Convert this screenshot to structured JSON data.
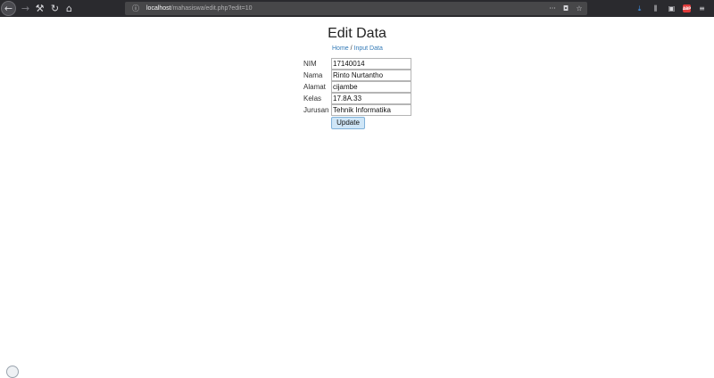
{
  "browser": {
    "url_host": "localhost",
    "url_path": "/mahasiswa/edit.php?edit=10"
  },
  "page": {
    "title": "Edit Data",
    "breadcrumb": {
      "home": "Home",
      "separator": " / ",
      "input_data": "Input Data"
    },
    "form": {
      "fields": [
        {
          "label": "NIM",
          "value": "17140014"
        },
        {
          "label": "Nama",
          "value": "Rinto Nurtantho"
        },
        {
          "label": "Alamat",
          "value": "cijambe"
        },
        {
          "label": "Kelas",
          "value": "17.8A.33"
        },
        {
          "label": "Jurusan",
          "value": "Tehnik Informatika"
        }
      ],
      "submit_label": "Update"
    }
  },
  "colors": {
    "toolbar_bg": "#2a2a2e",
    "link": "#337ab7",
    "button_bg": "#cfe6f7"
  }
}
